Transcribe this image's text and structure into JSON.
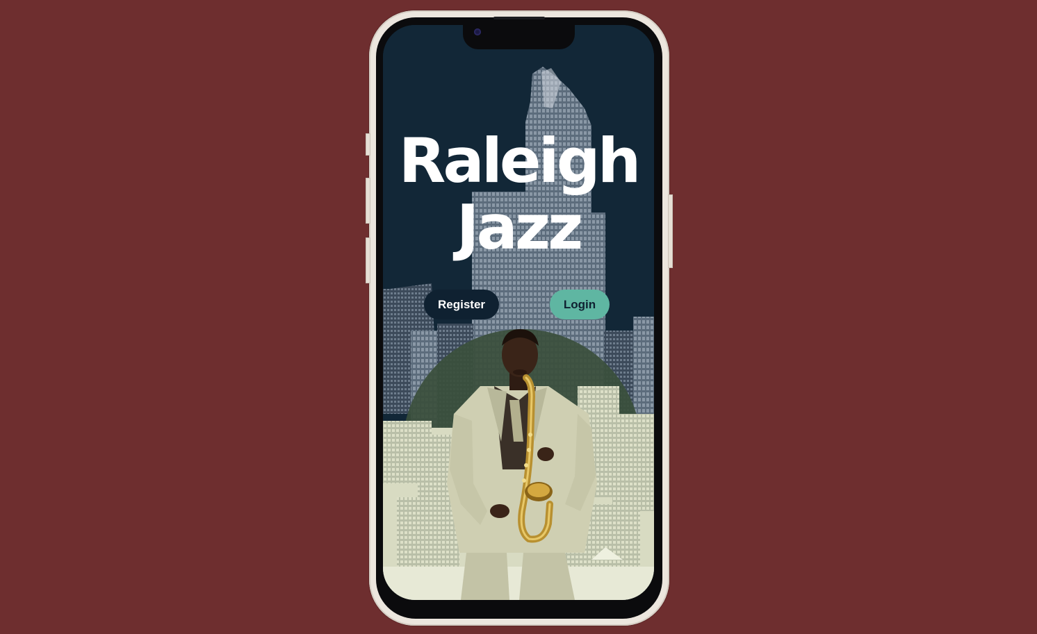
{
  "app": {
    "title_line1": "Raleigh",
    "title_line2": "Jazz"
  },
  "actions": {
    "register_label": "Register",
    "login_label": "Login"
  },
  "colors": {
    "page_background": "#6e2e2f",
    "screen_background": "#122737",
    "register_button": "#0f2131",
    "login_button": "#5fb6a2",
    "title_text": "#ffffff"
  },
  "images": {
    "hero": "saxophone-player-city-skyline"
  }
}
